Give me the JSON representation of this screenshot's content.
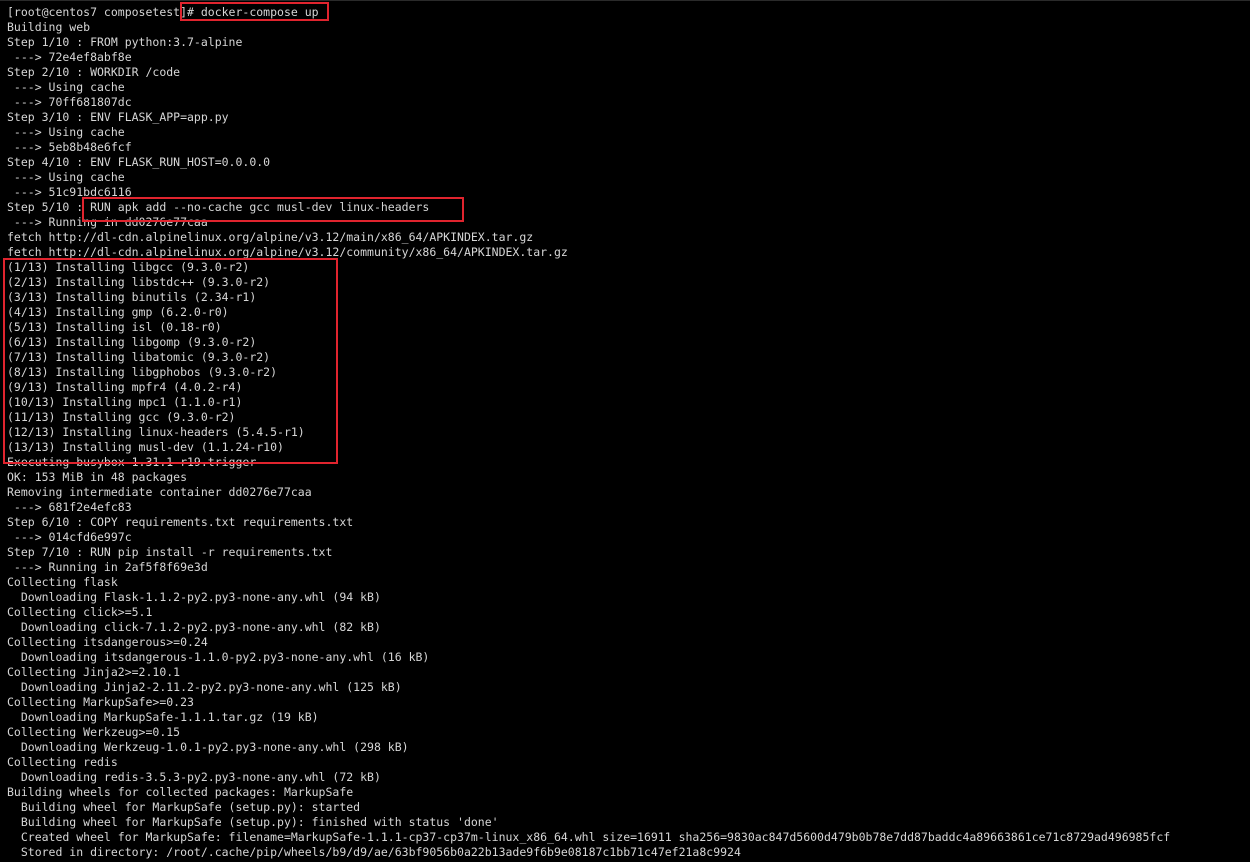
{
  "terminal": {
    "lines": [
      "[root@centos7 composetest]# docker-compose up",
      "Building web",
      "Step 1/10 : FROM python:3.7-alpine",
      " ---> 72e4ef8abf8e",
      "Step 2/10 : WORKDIR /code",
      " ---> Using cache",
      " ---> 70ff681807dc",
      "Step 3/10 : ENV FLASK_APP=app.py",
      " ---> Using cache",
      " ---> 5eb8b48e6fcf",
      "Step 4/10 : ENV FLASK_RUN_HOST=0.0.0.0",
      " ---> Using cache",
      " ---> 51c91bdc6116",
      "Step 5/10 : RUN apk add --no-cache gcc musl-dev linux-headers",
      " ---> Running in dd0276e77caa",
      "fetch http://dl-cdn.alpinelinux.org/alpine/v3.12/main/x86_64/APKINDEX.tar.gz",
      "fetch http://dl-cdn.alpinelinux.org/alpine/v3.12/community/x86_64/APKINDEX.tar.gz",
      "(1/13) Installing libgcc (9.3.0-r2)",
      "(2/13) Installing libstdc++ (9.3.0-r2)",
      "(3/13) Installing binutils (2.34-r1)",
      "(4/13) Installing gmp (6.2.0-r0)",
      "(5/13) Installing isl (0.18-r0)",
      "(6/13) Installing libgomp (9.3.0-r2)",
      "(7/13) Installing libatomic (9.3.0-r2)",
      "(8/13) Installing libgphobos (9.3.0-r2)",
      "(9/13) Installing mpfr4 (4.0.2-r4)",
      "(10/13) Installing mpc1 (1.1.0-r1)",
      "(11/13) Installing gcc (9.3.0-r2)",
      "(12/13) Installing linux-headers (5.4.5-r1)",
      "(13/13) Installing musl-dev (1.1.24-r10)",
      "Executing busybox-1.31.1-r19.trigger",
      "OK: 153 MiB in 48 packages",
      "Removing intermediate container dd0276e77caa",
      " ---> 681f2e4efc83",
      "Step 6/10 : COPY requirements.txt requirements.txt",
      " ---> 014cfd6e997c",
      "Step 7/10 : RUN pip install -r requirements.txt",
      " ---> Running in 2af5f8f69e3d",
      "Collecting flask",
      "  Downloading Flask-1.1.2-py2.py3-none-any.whl (94 kB)",
      "Collecting click>=5.1",
      "  Downloading click-7.1.2-py2.py3-none-any.whl (82 kB)",
      "Collecting itsdangerous>=0.24",
      "  Downloading itsdangerous-1.1.0-py2.py3-none-any.whl (16 kB)",
      "Collecting Jinja2>=2.10.1",
      "  Downloading Jinja2-2.11.2-py2.py3-none-any.whl (125 kB)",
      "Collecting MarkupSafe>=0.23",
      "  Downloading MarkupSafe-1.1.1.tar.gz (19 kB)",
      "Collecting Werkzeug>=0.15",
      "  Downloading Werkzeug-1.0.1-py2.py3-none-any.whl (298 kB)",
      "Collecting redis",
      "  Downloading redis-3.5.3-py2.py3-none-any.whl (72 kB)",
      "Building wheels for collected packages: MarkupSafe",
      "  Building wheel for MarkupSafe (setup.py): started",
      "  Building wheel for MarkupSafe (setup.py): finished with status 'done'",
      "  Created wheel for MarkupSafe: filename=MarkupSafe-1.1.1-cp37-cp37m-linux_x86_64.whl size=16911 sha256=9830ac847d5600d479b0b78e7dd87baddc4a89663861ce71c8729ad496985fcf",
      "  Stored in directory: /root/.cache/pip/wheels/b9/d9/ae/63bf9056b0a22b13ade9f6b9e08187c1bb71c47ef21a8c9924"
    ]
  },
  "colors": {
    "background": "#000000",
    "foreground": "#d6d6d6",
    "highlight": "#e0242e"
  }
}
